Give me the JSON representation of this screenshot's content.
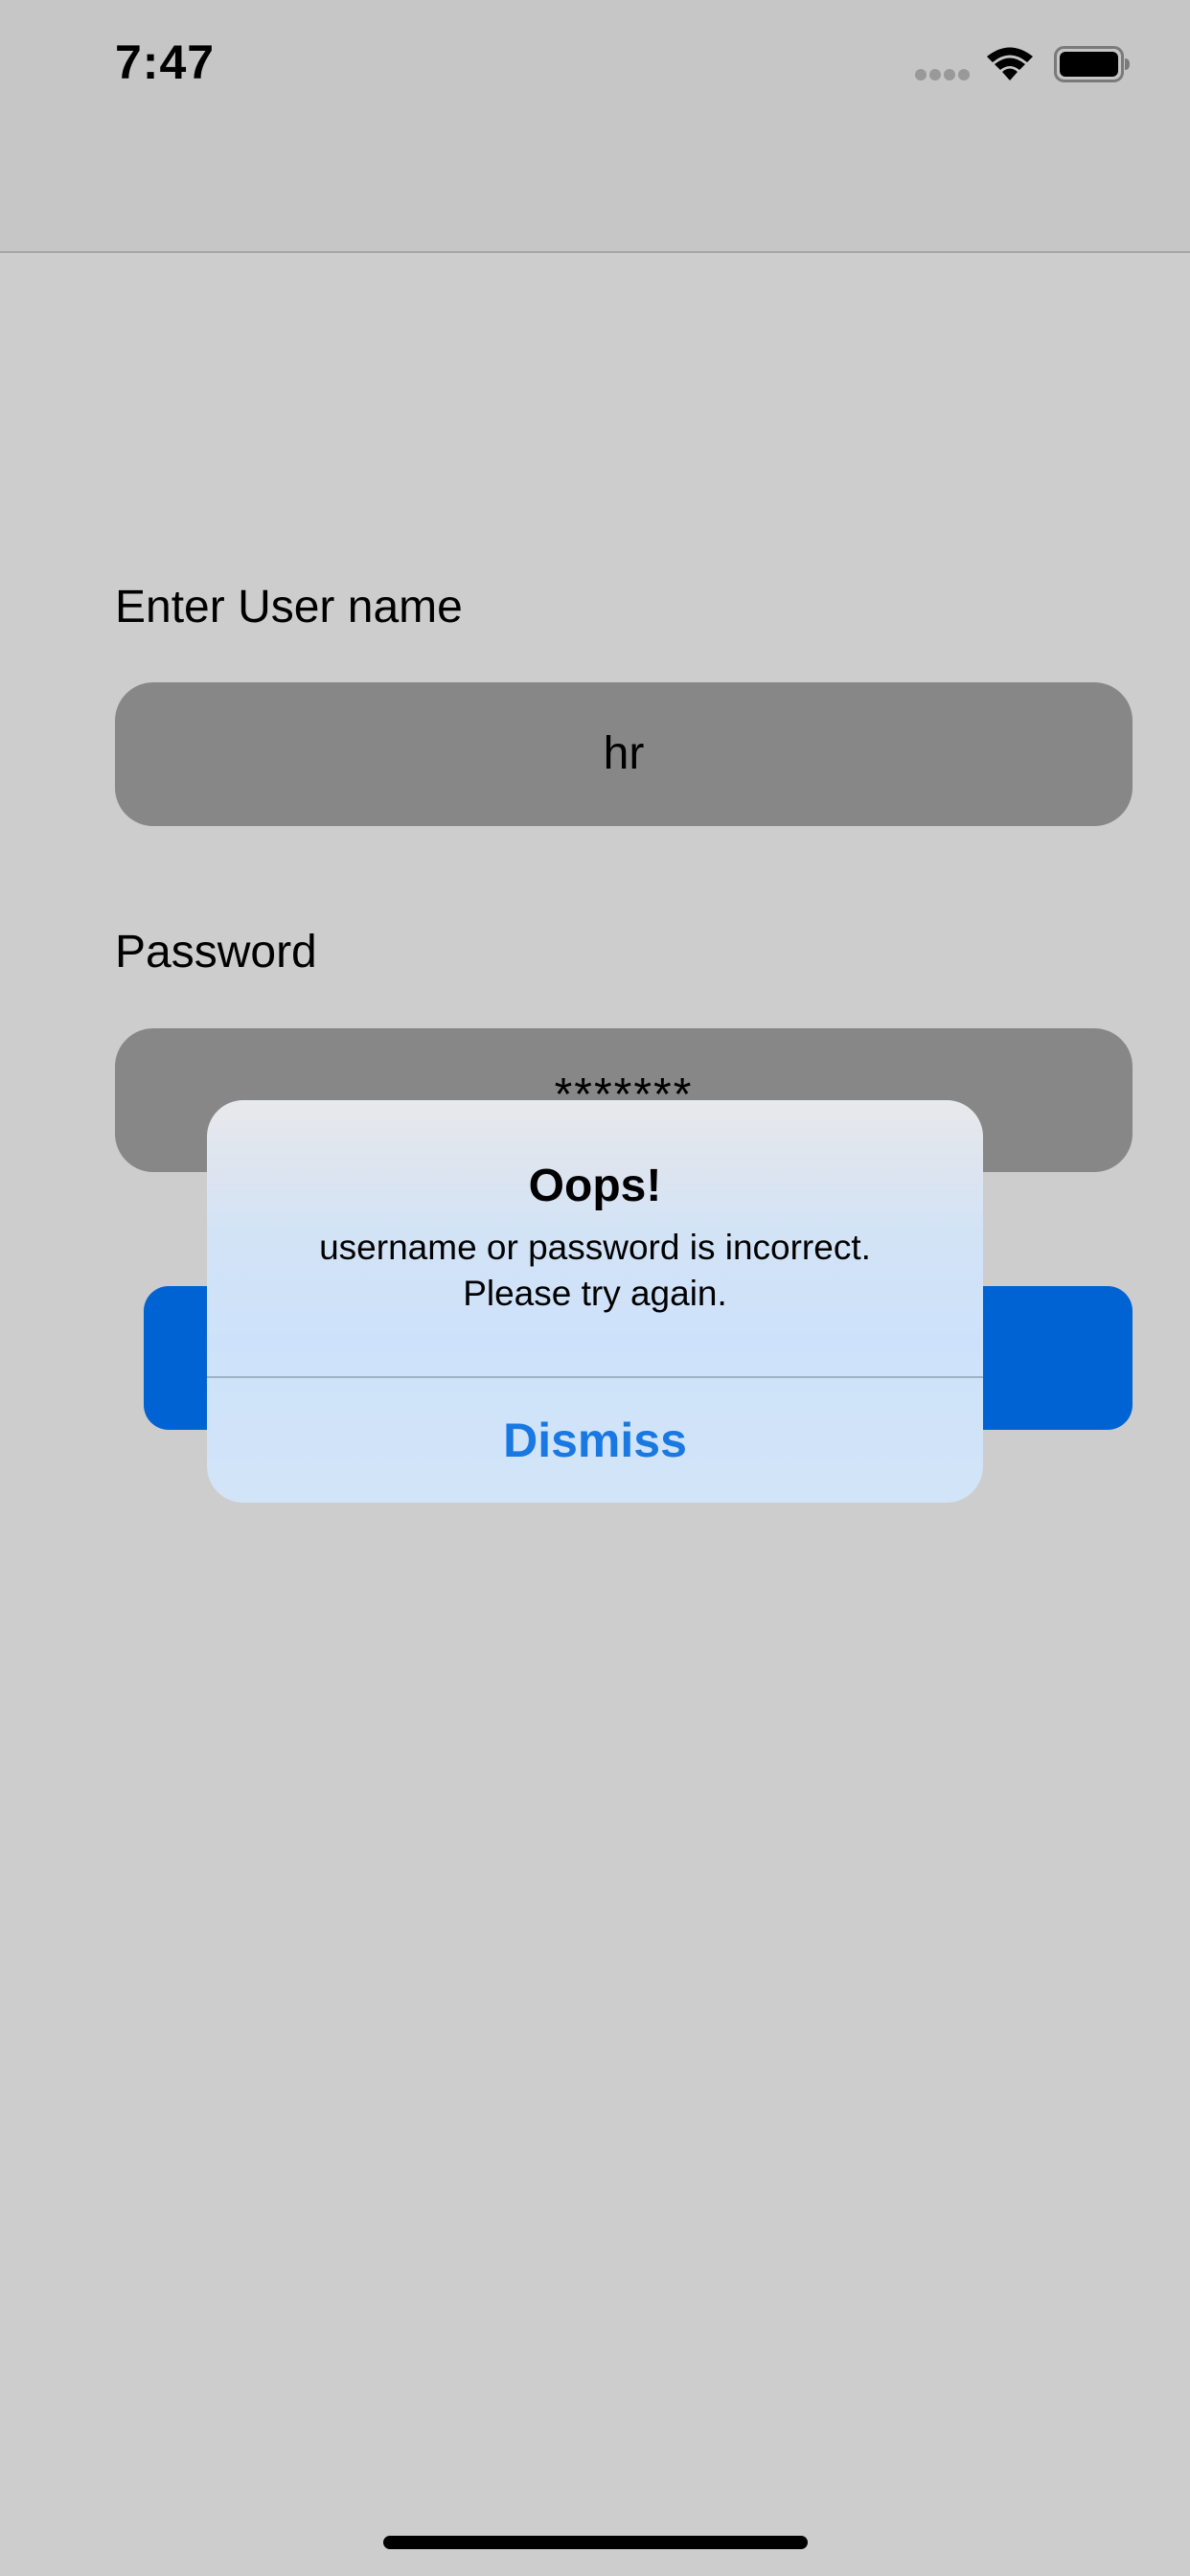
{
  "status_bar": {
    "time": "7:47",
    "icons": [
      "signal-icon",
      "wifi-icon",
      "battery-icon"
    ]
  },
  "form": {
    "username_label": "Enter User name",
    "username_value": "hr",
    "password_label": "Password",
    "password_value": "*******"
  },
  "alert": {
    "title": "Oops!",
    "message_line1": "username or password is incorrect.",
    "message_line2": "Please try again.",
    "dismiss_label": "Dismiss"
  },
  "colors": {
    "background": "#cdcdcd",
    "field": "#878787",
    "primary_button": "#0063d3",
    "alert_action": "#1a78e2"
  }
}
